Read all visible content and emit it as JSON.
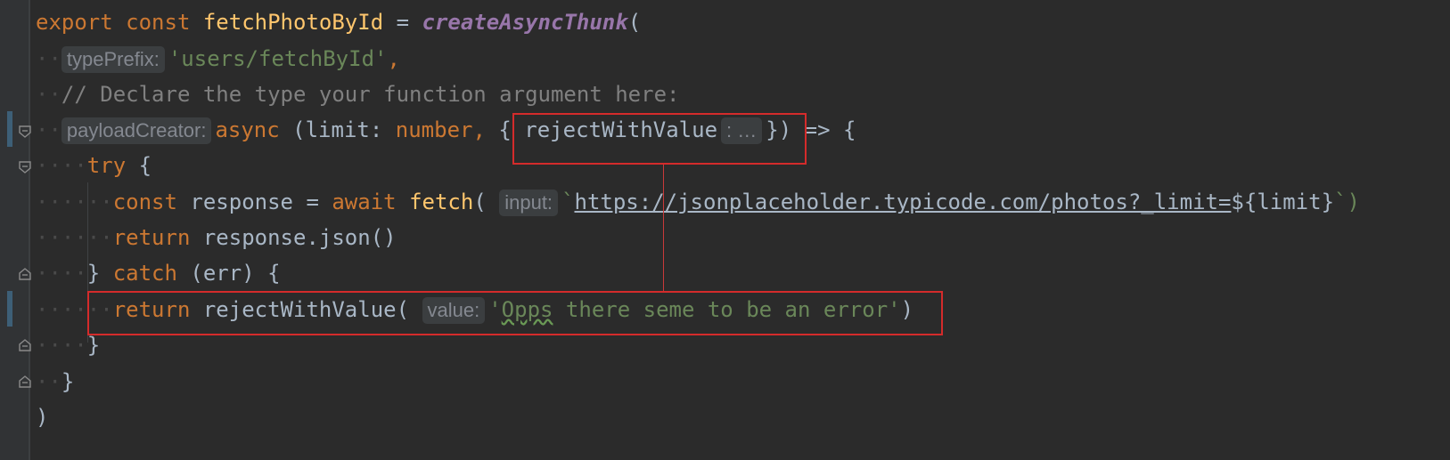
{
  "editor": {
    "lines": {
      "l1": {
        "export": "export",
        "const": "const",
        "name": "fetchPhotoById",
        "eq": "=",
        "call": "createAsyncThunk",
        "open": "("
      },
      "l2": {
        "hint": "typePrefix:",
        "value": "'users/fetchById'",
        "comma": ","
      },
      "l3": {
        "comment": "// Declare the type your function argument here:"
      },
      "l4": {
        "hint": "payloadCreator:",
        "async": "async",
        "params": "(limit:",
        "type": "number,",
        "brace_open": "{",
        "reject": "rejectWithValue",
        "hint2": ": …",
        "tail": "}) => {"
      },
      "l5": {
        "try": "try",
        "brace": "{"
      },
      "l6": {
        "const": "const",
        "var": "response",
        "eq": "=",
        "await": "await",
        "fetch": "fetch",
        "paren": "(",
        "hint": "input:",
        "tick": "`",
        "url": "https://jsonplaceholder.typicode.com/photos?_limit=",
        "interp": "${limit}",
        "close": "`)"
      },
      "l7": {
        "return": "return",
        "expr": "response.json()"
      },
      "l8": {
        "close": "}",
        "catch": "catch",
        "rest": "(err) {"
      },
      "l9": {
        "return": "return",
        "fn": "rejectWithValue(",
        "hint": "value:",
        "quote": "'",
        "word": "Opps",
        "rest": " there seme to be an error'",
        "close": ")"
      },
      "l10": {
        "brace": "}"
      },
      "l11": {
        "brace": "}"
      },
      "l12": {
        "paren": ")"
      }
    }
  },
  "colors": {
    "background": "#2b2b2b",
    "keyword": "#cc7832",
    "function": "#ffc66d",
    "string": "#6a8759",
    "comment": "#808080",
    "annotation": "#d42b2b"
  }
}
